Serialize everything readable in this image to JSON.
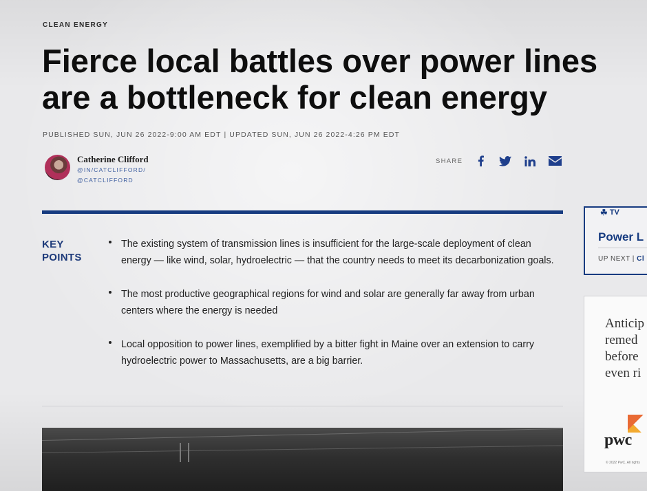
{
  "article": {
    "section": "CLEAN ENERGY",
    "headline_line1": "Fierce local battles over power lines",
    "headline_line2": "are a bottleneck for clean energy",
    "published": "PUBLISHED SUN, JUN 26 2022-9:00 AM EDT",
    "separator": "|",
    "updated": "UPDATED SUN, JUN 26 2022-4:26 PM EDT",
    "author": {
      "name": "Catherine Clifford",
      "linkedin": "@IN/CATCLIFFORD/",
      "twitter": "@CATCLIFFORD"
    }
  },
  "share": {
    "label": "SHARE",
    "icons": [
      "facebook-icon",
      "twitter-icon",
      "linkedin-icon",
      "email-icon"
    ]
  },
  "key_points": {
    "title_line1": "KEY",
    "title_line2": "POINTS",
    "items": [
      "The existing system of transmission lines is insufficient for the large-scale deployment of clean energy — like wind, solar, hydroelectric — that the country needs to meet its decarbonization goals.",
      "The most productive geographical regions for wind and solar are generally far away from urban centers where the energy is needed",
      "Local opposition to power lines, exemplified by a bitter fight in Maine over an extension to carry hydroelectric power to Massachusetts, are a big barrier."
    ]
  },
  "tv_widget": {
    "logo_text": "TV",
    "title": "Power L",
    "up_next_label": "UP NEXT |",
    "up_next_value": "Cl"
  },
  "ad": {
    "text": "Anticip\nremed\nbefore\neven ri",
    "brand": "pwc",
    "copyright": "© 2022 PwC. All rights"
  },
  "colors": {
    "accent_blue": "#163b80",
    "link_blue": "#3f5fa0",
    "text": "#111111",
    "background": "#e9e9eb"
  }
}
